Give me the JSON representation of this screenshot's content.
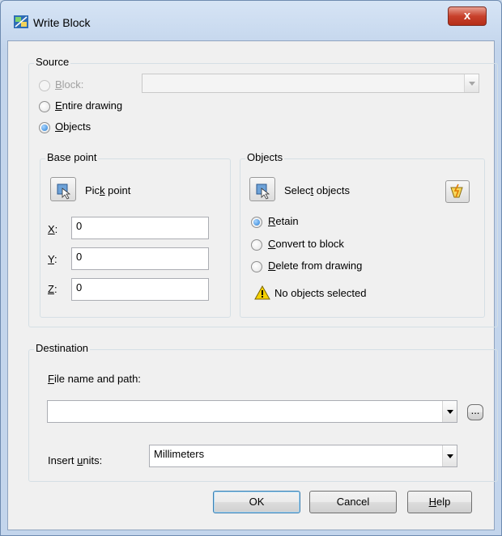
{
  "window": {
    "title": "Write Block",
    "close_glyph": "x"
  },
  "source": {
    "label": "Source",
    "block_label": "Block:",
    "block_value": "",
    "entire_drawing_label": "Entire drawing",
    "objects_label": "Objects",
    "selected": "objects"
  },
  "base_point": {
    "label": "Base point",
    "pick_point_label": "Pick point",
    "x_label": "X:",
    "x_value": "0",
    "y_label": "Y:",
    "y_value": "0",
    "z_label": "Z:",
    "z_value": "0"
  },
  "objects": {
    "label": "Objects",
    "select_objects_label": "Select objects",
    "retain_label": "Retain",
    "convert_label": "Convert to block",
    "delete_label": "Delete from drawing",
    "selected": "retain",
    "status_text": "No objects selected"
  },
  "destination": {
    "label": "Destination",
    "file_label": "File name and path:",
    "file_value": "",
    "browse_label": "...",
    "units_label": "Insert units:",
    "units_value": "Millimeters"
  },
  "buttons": {
    "ok": "OK",
    "cancel": "Cancel",
    "help": "Help"
  },
  "colors": {
    "accent": "#2a7fd4",
    "close": "#c8412c",
    "warning": "#f5d100"
  }
}
